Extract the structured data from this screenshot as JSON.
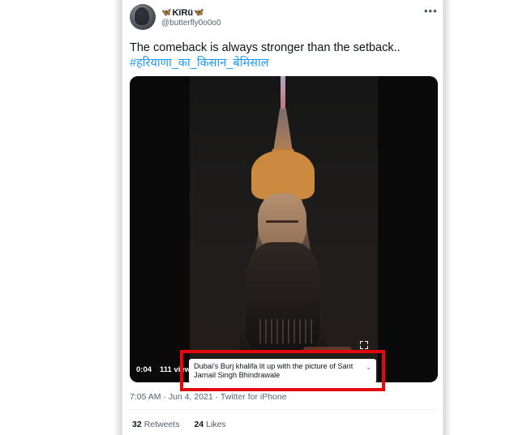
{
  "user": {
    "name": "KīRü",
    "handle": "@butterfly0o0o0",
    "badge_left": "🦋",
    "badge_right": "🦋"
  },
  "more_label": "•••",
  "tweet": {
    "text": "The comeback is always stronger than the setback..",
    "hashtag": "#हरियाणा_का_किसान_बेमिसाल"
  },
  "video": {
    "time": "0:04",
    "views": "111 views",
    "caption": "Dubai's Burj khalifa lit up with the picture of Sant Jarnail Singh Bhindrawale",
    "caption_chevron": "⌄"
  },
  "meta": "7:05 AM · Jun 4, 2021 · Twitter for iPhone",
  "stats": {
    "retweets_count": "32",
    "retweets_label": "Retweets",
    "likes_count": "24",
    "likes_label": "Likes"
  },
  "colors": {
    "link": "#1d9bf0",
    "highlight_box": "#e3080f"
  }
}
